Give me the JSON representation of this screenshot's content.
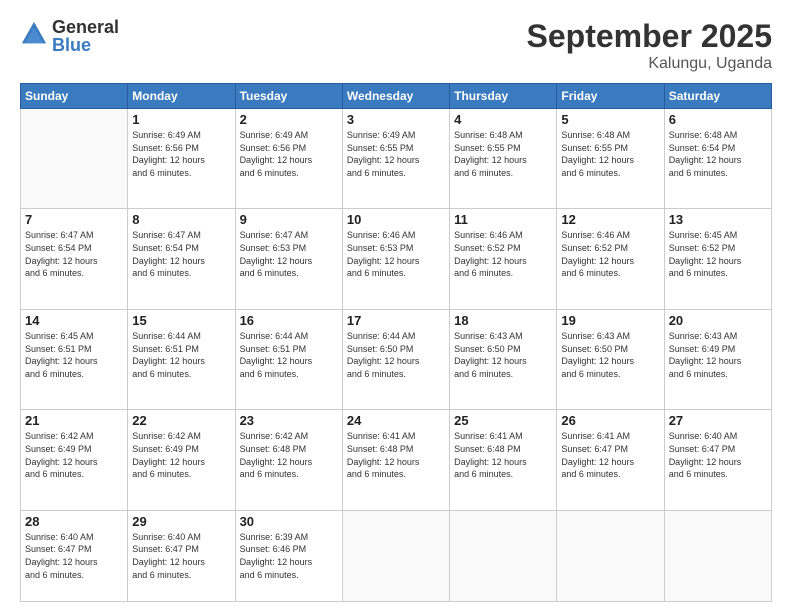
{
  "logo": {
    "general": "General",
    "blue": "Blue"
  },
  "header": {
    "month": "September 2025",
    "location": "Kalungu, Uganda"
  },
  "days_of_week": [
    "Sunday",
    "Monday",
    "Tuesday",
    "Wednesday",
    "Thursday",
    "Friday",
    "Saturday"
  ],
  "weeks": [
    [
      {
        "day": "",
        "sunrise": "",
        "sunset": "",
        "daylight": ""
      },
      {
        "day": "1",
        "sunrise": "Sunrise: 6:49 AM",
        "sunset": "Sunset: 6:56 PM",
        "daylight": "Daylight: 12 hours and 6 minutes."
      },
      {
        "day": "2",
        "sunrise": "Sunrise: 6:49 AM",
        "sunset": "Sunset: 6:56 PM",
        "daylight": "Daylight: 12 hours and 6 minutes."
      },
      {
        "day": "3",
        "sunrise": "Sunrise: 6:49 AM",
        "sunset": "Sunset: 6:55 PM",
        "daylight": "Daylight: 12 hours and 6 minutes."
      },
      {
        "day": "4",
        "sunrise": "Sunrise: 6:48 AM",
        "sunset": "Sunset: 6:55 PM",
        "daylight": "Daylight: 12 hours and 6 minutes."
      },
      {
        "day": "5",
        "sunrise": "Sunrise: 6:48 AM",
        "sunset": "Sunset: 6:55 PM",
        "daylight": "Daylight: 12 hours and 6 minutes."
      },
      {
        "day": "6",
        "sunrise": "Sunrise: 6:48 AM",
        "sunset": "Sunset: 6:54 PM",
        "daylight": "Daylight: 12 hours and 6 minutes."
      }
    ],
    [
      {
        "day": "7",
        "sunrise": "Sunrise: 6:47 AM",
        "sunset": "Sunset: 6:54 PM",
        "daylight": "Daylight: 12 hours and 6 minutes."
      },
      {
        "day": "8",
        "sunrise": "Sunrise: 6:47 AM",
        "sunset": "Sunset: 6:54 PM",
        "daylight": "Daylight: 12 hours and 6 minutes."
      },
      {
        "day": "9",
        "sunrise": "Sunrise: 6:47 AM",
        "sunset": "Sunset: 6:53 PM",
        "daylight": "Daylight: 12 hours and 6 minutes."
      },
      {
        "day": "10",
        "sunrise": "Sunrise: 6:46 AM",
        "sunset": "Sunset: 6:53 PM",
        "daylight": "Daylight: 12 hours and 6 minutes."
      },
      {
        "day": "11",
        "sunrise": "Sunrise: 6:46 AM",
        "sunset": "Sunset: 6:52 PM",
        "daylight": "Daylight: 12 hours and 6 minutes."
      },
      {
        "day": "12",
        "sunrise": "Sunrise: 6:46 AM",
        "sunset": "Sunset: 6:52 PM",
        "daylight": "Daylight: 12 hours and 6 minutes."
      },
      {
        "day": "13",
        "sunrise": "Sunrise: 6:45 AM",
        "sunset": "Sunset: 6:52 PM",
        "daylight": "Daylight: 12 hours and 6 minutes."
      }
    ],
    [
      {
        "day": "14",
        "sunrise": "Sunrise: 6:45 AM",
        "sunset": "Sunset: 6:51 PM",
        "daylight": "Daylight: 12 hours and 6 minutes."
      },
      {
        "day": "15",
        "sunrise": "Sunrise: 6:44 AM",
        "sunset": "Sunset: 6:51 PM",
        "daylight": "Daylight: 12 hours and 6 minutes."
      },
      {
        "day": "16",
        "sunrise": "Sunrise: 6:44 AM",
        "sunset": "Sunset: 6:51 PM",
        "daylight": "Daylight: 12 hours and 6 minutes."
      },
      {
        "day": "17",
        "sunrise": "Sunrise: 6:44 AM",
        "sunset": "Sunset: 6:50 PM",
        "daylight": "Daylight: 12 hours and 6 minutes."
      },
      {
        "day": "18",
        "sunrise": "Sunrise: 6:43 AM",
        "sunset": "Sunset: 6:50 PM",
        "daylight": "Daylight: 12 hours and 6 minutes."
      },
      {
        "day": "19",
        "sunrise": "Sunrise: 6:43 AM",
        "sunset": "Sunset: 6:50 PM",
        "daylight": "Daylight: 12 hours and 6 minutes."
      },
      {
        "day": "20",
        "sunrise": "Sunrise: 6:43 AM",
        "sunset": "Sunset: 6:49 PM",
        "daylight": "Daylight: 12 hours and 6 minutes."
      }
    ],
    [
      {
        "day": "21",
        "sunrise": "Sunrise: 6:42 AM",
        "sunset": "Sunset: 6:49 PM",
        "daylight": "Daylight: 12 hours and 6 minutes."
      },
      {
        "day": "22",
        "sunrise": "Sunrise: 6:42 AM",
        "sunset": "Sunset: 6:49 PM",
        "daylight": "Daylight: 12 hours and 6 minutes."
      },
      {
        "day": "23",
        "sunrise": "Sunrise: 6:42 AM",
        "sunset": "Sunset: 6:48 PM",
        "daylight": "Daylight: 12 hours and 6 minutes."
      },
      {
        "day": "24",
        "sunrise": "Sunrise: 6:41 AM",
        "sunset": "Sunset: 6:48 PM",
        "daylight": "Daylight: 12 hours and 6 minutes."
      },
      {
        "day": "25",
        "sunrise": "Sunrise: 6:41 AM",
        "sunset": "Sunset: 6:48 PM",
        "daylight": "Daylight: 12 hours and 6 minutes."
      },
      {
        "day": "26",
        "sunrise": "Sunrise: 6:41 AM",
        "sunset": "Sunset: 6:47 PM",
        "daylight": "Daylight: 12 hours and 6 minutes."
      },
      {
        "day": "27",
        "sunrise": "Sunrise: 6:40 AM",
        "sunset": "Sunset: 6:47 PM",
        "daylight": "Daylight: 12 hours and 6 minutes."
      }
    ],
    [
      {
        "day": "28",
        "sunrise": "Sunrise: 6:40 AM",
        "sunset": "Sunset: 6:47 PM",
        "daylight": "Daylight: 12 hours and 6 minutes."
      },
      {
        "day": "29",
        "sunrise": "Sunrise: 6:40 AM",
        "sunset": "Sunset: 6:47 PM",
        "daylight": "Daylight: 12 hours and 6 minutes."
      },
      {
        "day": "30",
        "sunrise": "Sunrise: 6:39 AM",
        "sunset": "Sunset: 6:46 PM",
        "daylight": "Daylight: 12 hours and 6 minutes."
      },
      {
        "day": "",
        "sunrise": "",
        "sunset": "",
        "daylight": ""
      },
      {
        "day": "",
        "sunrise": "",
        "sunset": "",
        "daylight": ""
      },
      {
        "day": "",
        "sunrise": "",
        "sunset": "",
        "daylight": ""
      },
      {
        "day": "",
        "sunrise": "",
        "sunset": "",
        "daylight": ""
      }
    ]
  ]
}
